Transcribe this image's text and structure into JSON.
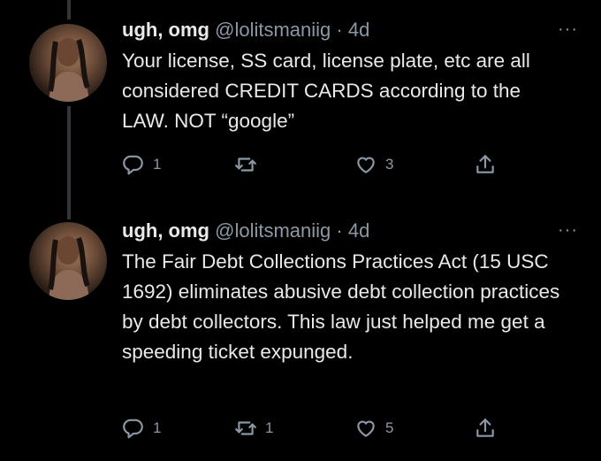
{
  "tweets": [
    {
      "display_name": "ugh, omg",
      "handle": "@lolitsmaniig",
      "separator": "·",
      "time": "4d",
      "more": "···",
      "text": "Your license, SS card, license plate, etc are all considered CREDIT CARDS according to the LAW. NOT “google”",
      "replies": "1",
      "retweets": "",
      "likes": "3"
    },
    {
      "display_name": "ugh, omg",
      "handle": "@lolitsmaniig",
      "separator": "·",
      "time": "4d",
      "more": "···",
      "text": "The Fair Debt Collections Practices Act (15 USC 1692) eliminates abusive debt collection practices by debt collectors. This law just helped me get a speeding ticket expunged.",
      "replies": "1",
      "retweets": "1",
      "likes": "5"
    }
  ],
  "icons": {
    "reply": "reply-icon",
    "retweet": "retweet-icon",
    "like": "like-icon",
    "share": "share-icon"
  },
  "colors": {
    "background": "#000000",
    "text": "#e7e9ea",
    "secondary": "#8b98a5",
    "thread_line": "#333639"
  }
}
